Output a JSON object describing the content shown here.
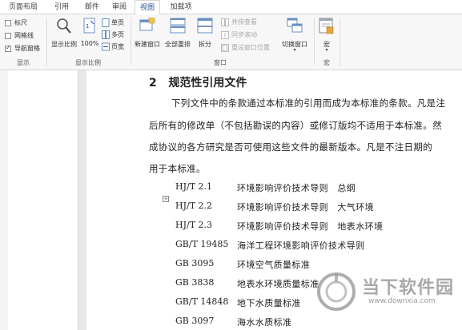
{
  "tabs": [
    {
      "label": "页面布局",
      "active": false
    },
    {
      "label": "引用",
      "active": false
    },
    {
      "label": "邮件",
      "active": false
    },
    {
      "label": "审阅",
      "active": false
    },
    {
      "label": "视图",
      "active": true
    },
    {
      "label": "加载项",
      "active": false
    }
  ],
  "ribbon": {
    "show": {
      "ruler": {
        "label": "标尺",
        "checked": false
      },
      "gridlines": {
        "label": "网格线",
        "checked": false
      },
      "nav_pane": {
        "label": "导航窗格",
        "checked": true
      },
      "group_label": "显示"
    },
    "zoom": {
      "zoom_button": "显示比例",
      "percent_button": "100%",
      "one_page": "单页",
      "multi_page": "多页",
      "page_width": "页宽",
      "group_label": "显示比例"
    },
    "window": {
      "new_window": "新建窗口",
      "arrange_all": "全部重排",
      "split": "拆分",
      "side_by_side": "并排查看",
      "sync_scroll": "同步滚动",
      "reset_position": "重设窗口位置",
      "switch_window": "切换窗口",
      "group_label": "窗口"
    },
    "macros": {
      "macro_button": "宏",
      "group_label": "宏"
    }
  },
  "document": {
    "heading_number": "2",
    "heading_text": "规范性引用文件",
    "paragraph_lines": [
      "下列文件中的条款通过本标准的引用而成为本标准的条款。凡是注",
      "后所有的修改单（不包括勘误的内容）或修订版均不适用于本标准。然",
      "成协议的各方研究是否可使用这些文件的最新版本。凡是不注日期的",
      "用于本标准。"
    ],
    "anchor_glyph": "+",
    "references": [
      {
        "code": "HJ/T 2.1",
        "title": "环境影响评价技术导则　总纲"
      },
      {
        "code": "HJ/T 2.2",
        "title": "环境影响评价技术导则　大气环境"
      },
      {
        "code": "HJ/T 2.3",
        "title": "环境影响评价技术导则　地表水环境"
      },
      {
        "code": "GB/T 19485",
        "title": "海洋工程环境影响评价技术导则"
      },
      {
        "code": "GB 3095",
        "title": "环境空气质量标准"
      },
      {
        "code": "GB 3838",
        "title": "地表水环境质量标准"
      },
      {
        "code": "GB/T 14848",
        "title": "地下水质量标准"
      },
      {
        "code": "GB 3097",
        "title": "海水水质标准"
      }
    ]
  },
  "watermark": {
    "name": "当下软件园",
    "url": "www.downxia.com"
  },
  "colors": {
    "accent": "#2b579a",
    "ribbon_bg": "#f7f7f7",
    "watermark": "#9a9a9a"
  }
}
